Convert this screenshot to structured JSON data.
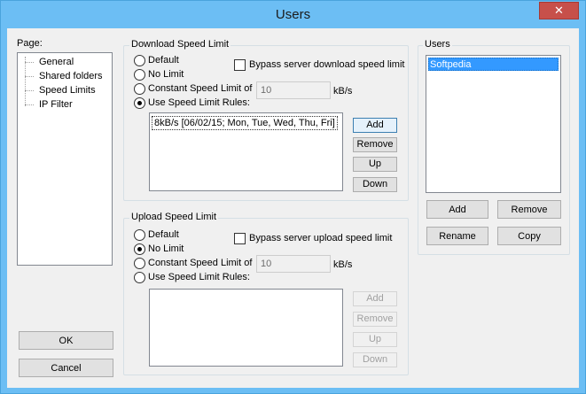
{
  "window": {
    "title": "Users",
    "close_glyph": "✕"
  },
  "page_panel": {
    "label": "Page:",
    "items": [
      "General",
      "Shared folders",
      "Speed Limits",
      "IP Filter"
    ]
  },
  "download": {
    "group_title": "Download Speed Limit",
    "options": [
      "Default",
      "No Limit",
      "Constant Speed Limit of",
      "Use Speed Limit Rules:"
    ],
    "selected": "Use Speed Limit Rules:",
    "bypass_label": "Bypass server download speed limit",
    "bypass_checked": false,
    "speed_value": "10",
    "speed_unit": "kB/s",
    "rules": [
      "8kB/s [06/02/15; Mon, Tue, Wed, Thu, Fri]"
    ],
    "buttons": {
      "add": "Add",
      "remove": "Remove",
      "up": "Up",
      "down": "Down"
    }
  },
  "upload": {
    "group_title": "Upload Speed Limit",
    "options": [
      "Default",
      "No Limit",
      "Constant Speed Limit of",
      "Use Speed Limit Rules:"
    ],
    "selected": "No Limit",
    "bypass_label": "Bypass server upload speed limit",
    "bypass_checked": false,
    "speed_value": "10",
    "speed_unit": "kB/s",
    "rules": [],
    "buttons": {
      "add": "Add",
      "remove": "Remove",
      "up": "Up",
      "down": "Down"
    }
  },
  "users": {
    "group_title": "Users",
    "list": [
      "Softpedia"
    ],
    "selected": "Softpedia",
    "buttons": {
      "add": "Add",
      "remove": "Remove",
      "rename": "Rename",
      "copy": "Copy"
    }
  },
  "dialog_buttons": {
    "ok": "OK",
    "cancel": "Cancel"
  }
}
